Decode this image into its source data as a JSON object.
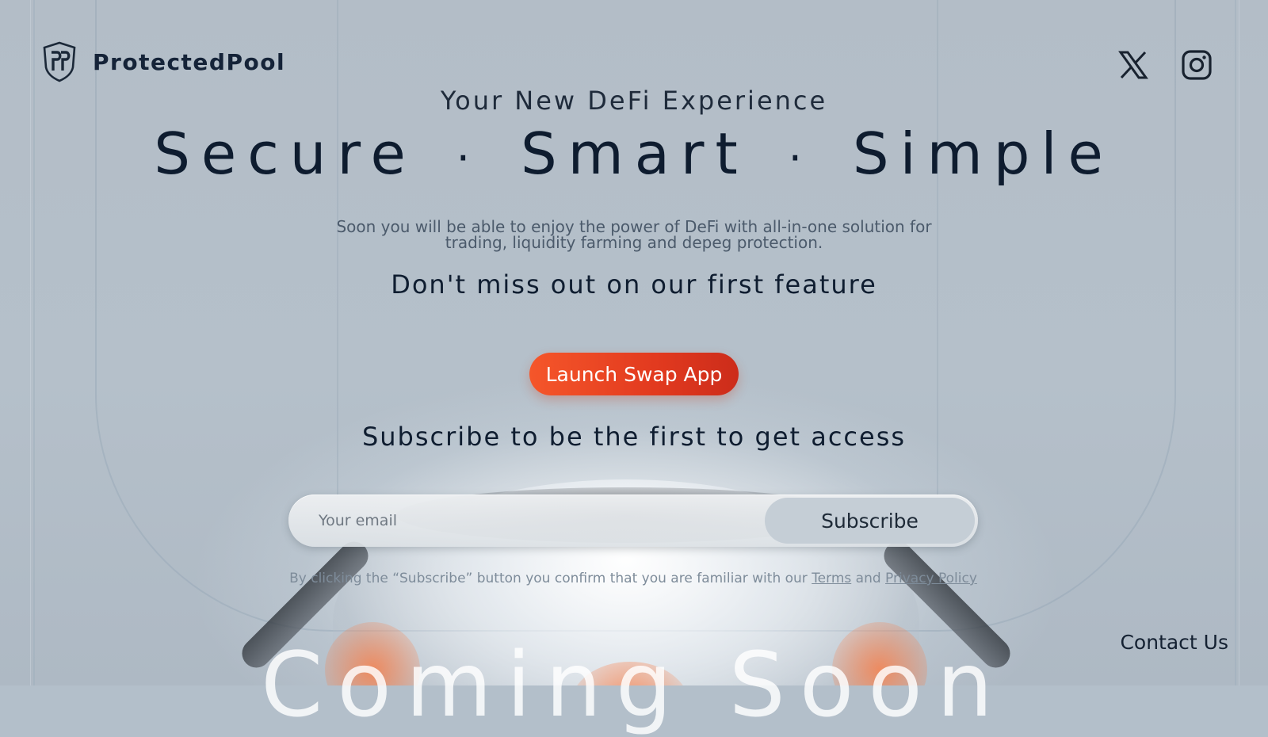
{
  "brand": {
    "name": "ProtectedPool",
    "logo_icon": "shield-pp-logo-icon"
  },
  "social": {
    "items": [
      {
        "name": "x",
        "icon": "x-icon"
      },
      {
        "name": "instagram",
        "icon": "instagram-icon"
      }
    ]
  },
  "hero": {
    "kicker": "Your New DeFi Experience",
    "words": [
      "Secure",
      "Smart",
      "Simple"
    ],
    "separator": "·",
    "description": "Soon you will be able to enjoy the power of DeFi with all-in-one solution for trading, liquidity farming and depeg protection.",
    "tease": "Don't miss out on our first feature",
    "launch_label": "Launch Swap App"
  },
  "subscribe": {
    "title": "Subscribe to be the first to get access",
    "email_placeholder": "Your email",
    "button_label": "Subscribe",
    "consent_prefix": "By clicking the “Subscribe” button you confirm that you are familiar with our ",
    "terms_label": "Terms",
    "consent_and": " and ",
    "privacy_label": "Privacy Policy"
  },
  "footer": {
    "contact_label": "Contact Us",
    "coming_soon": "Coming Soon"
  },
  "colors": {
    "background": "#b3bfca",
    "accent": "#e8401f",
    "text_dark": "#0f1d30"
  }
}
